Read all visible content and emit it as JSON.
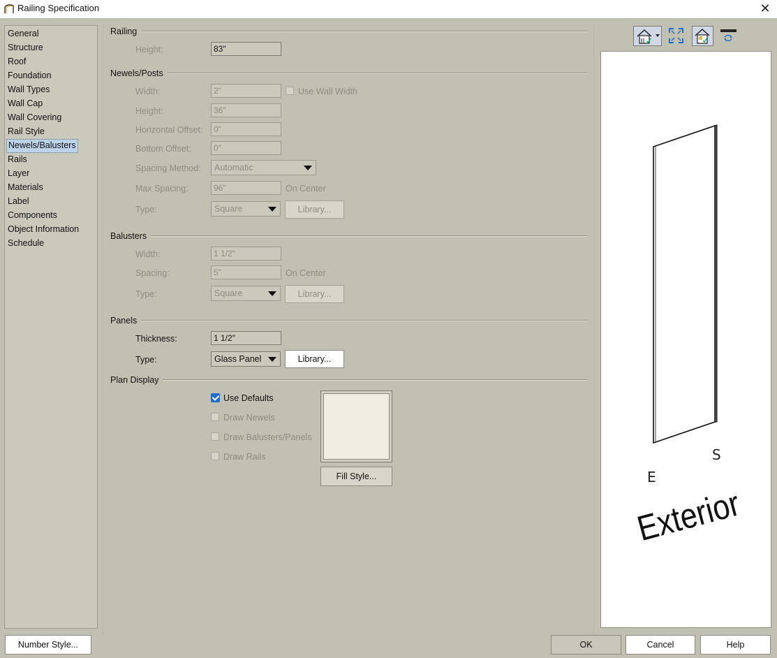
{
  "window": {
    "title": "Railing Specification"
  },
  "nav": {
    "items": [
      {
        "label": "General"
      },
      {
        "label": "Structure"
      },
      {
        "label": "Roof"
      },
      {
        "label": "Foundation"
      },
      {
        "label": "Wall Types"
      },
      {
        "label": "Wall Cap"
      },
      {
        "label": "Wall Covering"
      },
      {
        "label": "Rail Style"
      },
      {
        "label": "Newels/Balusters"
      },
      {
        "label": "Rails"
      },
      {
        "label": "Layer"
      },
      {
        "label": "Materials"
      },
      {
        "label": "Label"
      },
      {
        "label": "Components"
      },
      {
        "label": "Object Information"
      },
      {
        "label": "Schedule"
      }
    ],
    "selected": "Newels/Balusters"
  },
  "railing": {
    "heading": "Railing",
    "height_label": "Height:",
    "height_value": "83\""
  },
  "newels": {
    "heading": "Newels/Posts",
    "width_label": "Width:",
    "width_value": "2\"",
    "use_wall_width_label": "Use Wall Width",
    "height_label": "Height:",
    "height_value": "36\"",
    "hoffset_label": "Horizontal Offset:",
    "hoffset_value": "0\"",
    "boffset_label": "Bottom Offset:",
    "boffset_value": "0\"",
    "spacing_method_label": "Spacing Method:",
    "spacing_method_value": "Automatic",
    "max_spacing_label": "Max Spacing:",
    "max_spacing_value": "96\"",
    "on_center": "On Center",
    "type_label": "Type:",
    "type_value": "Square",
    "library_label": "Library..."
  },
  "balusters": {
    "heading": "Balusters",
    "width_label": "Width:",
    "width_value": "1 1/2\"",
    "spacing_label": "Spacing:",
    "spacing_value": "5\"",
    "on_center": "On Center",
    "type_label": "Type:",
    "type_value": "Square",
    "library_label": "Library..."
  },
  "panels": {
    "heading": "Panels",
    "thickness_label": "Thickness:",
    "thickness_value": "1 1/2\"",
    "type_label": "Type:",
    "type_value": "Glass Panel",
    "library_label": "Library..."
  },
  "plan_display": {
    "heading": "Plan Display",
    "use_defaults": "Use Defaults",
    "use_defaults_checked": true,
    "draw_newels": "Draw Newels",
    "draw_balusters": "Draw Balusters/Panels",
    "draw_rails": "Draw Rails",
    "fill_style_label": "Fill Style...",
    "fill_color": "#eeeee2"
  },
  "preview": {
    "label_e": "E",
    "label_s": "S",
    "label_exterior": "Exterior"
  },
  "footer": {
    "number_style": "Number Style...",
    "ok": "OK",
    "cancel": "Cancel",
    "help": "Help"
  },
  "colors": {
    "background": "#c1c1b3",
    "selection": "#bcd3e8",
    "check_accent": "#1f6fc6"
  },
  "toolbar_icons": [
    "camera-view-icon",
    "fill-window-icon",
    "show-checked-icon",
    "refresh-icon"
  ]
}
